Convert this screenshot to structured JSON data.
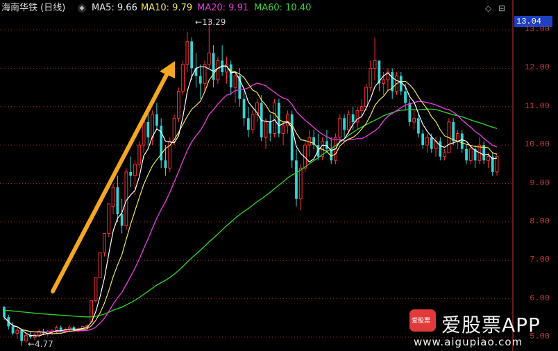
{
  "header": {
    "title": "海南华铁 (日线)",
    "ma5": "MA5: 9.66",
    "ma10": "MA10: 9.79",
    "ma20": "MA20: 9.91",
    "ma60": "MA60: 10.40"
  },
  "current_price": "13.04",
  "watermark": {
    "logo_text": "爱股票",
    "name": "爱股票APP",
    "url": "www.aigupiao.com"
  },
  "colors": {
    "up": "#ff3030",
    "down": "#35d4d4",
    "ma5": "#ffffff",
    "ma10": "#f2e65a",
    "ma20": "#e23ad8",
    "ma60": "#2ecc2e",
    "arrow": "#f5a623",
    "axis": "#c23a3a",
    "grid": "#a0282a"
  },
  "chart_data": {
    "type": "candlestick",
    "title": "海南华铁 (日线)",
    "y_ticks": [
      "13.00",
      "12.00",
      "11.00",
      "10.00",
      "9.00",
      "8.00",
      "7.00",
      "6.00",
      "5.00"
    ],
    "ylim": [
      4.6,
      13.3
    ],
    "annotations": {
      "high": "13.29",
      "low": "4.77"
    },
    "ohlc": [
      [
        5.78,
        5.82,
        5.45,
        5.52
      ],
      [
        5.52,
        5.58,
        5.2,
        5.28
      ],
      [
        5.28,
        5.4,
        5.05,
        5.1
      ],
      [
        5.1,
        5.25,
        4.95,
        5.18
      ],
      [
        5.18,
        5.22,
        4.77,
        4.9
      ],
      [
        4.9,
        5.1,
        4.85,
        5.05
      ],
      [
        5.05,
        5.15,
        4.95,
        5.0
      ],
      [
        5.0,
        5.1,
        4.92,
        5.06
      ],
      [
        5.06,
        5.2,
        5.0,
        5.15
      ],
      [
        5.15,
        5.22,
        5.05,
        5.1
      ],
      [
        5.1,
        5.18,
        5.02,
        5.14
      ],
      [
        5.14,
        5.2,
        5.06,
        5.18
      ],
      [
        5.18,
        5.3,
        5.1,
        5.25
      ],
      [
        5.25,
        5.3,
        5.12,
        5.16
      ],
      [
        5.16,
        5.25,
        5.1,
        5.2
      ],
      [
        5.2,
        5.3,
        5.15,
        5.26
      ],
      [
        5.26,
        5.3,
        5.15,
        5.18
      ],
      [
        5.18,
        5.25,
        5.12,
        5.22
      ],
      [
        5.22,
        5.3,
        5.15,
        5.28
      ],
      [
        5.28,
        5.35,
        5.2,
        5.3
      ],
      [
        5.4,
        5.95,
        5.4,
        5.95
      ],
      [
        5.95,
        6.55,
        5.9,
        6.55
      ],
      [
        6.55,
        7.2,
        6.55,
        7.2
      ],
      [
        7.2,
        7.7,
        7.1,
        7.7
      ],
      [
        7.7,
        8.47,
        7.6,
        8.47
      ],
      [
        8.4,
        9.0,
        8.2,
        8.9
      ],
      [
        8.9,
        9.2,
        8.0,
        8.2
      ],
      [
        8.2,
        8.6,
        7.7,
        7.9
      ],
      [
        7.9,
        9.4,
        7.8,
        9.3
      ],
      [
        9.3,
        9.7,
        8.9,
        9.2
      ],
      [
        9.2,
        9.6,
        8.7,
        9.5
      ],
      [
        9.5,
        10.1,
        9.4,
        10.0
      ],
      [
        10.0,
        10.7,
        9.8,
        10.6
      ],
      [
        10.6,
        10.9,
        10.0,
        10.2
      ],
      [
        10.2,
        10.9,
        10.0,
        10.8
      ],
      [
        10.8,
        11.1,
        10.4,
        10.5
      ],
      [
        10.5,
        10.7,
        9.4,
        9.6
      ],
      [
        9.6,
        10.0,
        9.2,
        9.4
      ],
      [
        9.4,
        10.2,
        9.3,
        10.1
      ],
      [
        10.1,
        10.8,
        10.0,
        10.7
      ],
      [
        10.7,
        11.5,
        10.6,
        11.4
      ],
      [
        11.4,
        12.2,
        11.3,
        12.1
      ],
      [
        12.1,
        12.95,
        11.9,
        12.7
      ],
      [
        12.7,
        12.8,
        11.7,
        12.0
      ],
      [
        12.0,
        12.4,
        11.5,
        11.8
      ],
      [
        11.8,
        12.1,
        11.2,
        11.6
      ],
      [
        11.6,
        12.2,
        11.4,
        12.1
      ],
      [
        12.1,
        13.29,
        12.0,
        12.4
      ],
      [
        12.4,
        12.6,
        11.5,
        11.7
      ],
      [
        11.7,
        12.3,
        11.6,
        12.2
      ],
      [
        12.2,
        12.6,
        11.8,
        11.9
      ],
      [
        11.9,
        12.3,
        11.6,
        12.1
      ],
      [
        12.1,
        12.2,
        11.3,
        11.5
      ],
      [
        11.5,
        11.9,
        11.1,
        11.8
      ],
      [
        11.8,
        12.0,
        11.0,
        11.2
      ],
      [
        11.2,
        11.4,
        10.5,
        10.7
      ],
      [
        10.7,
        11.0,
        10.2,
        10.4
      ],
      [
        10.4,
        10.9,
        10.3,
        10.8
      ],
      [
        10.8,
        11.2,
        10.6,
        11.1
      ],
      [
        11.1,
        11.3,
        10.1,
        10.2
      ],
      [
        10.2,
        10.7,
        9.9,
        10.6
      ],
      [
        10.6,
        10.8,
        10.1,
        10.3
      ],
      [
        10.3,
        11.2,
        10.2,
        11.1
      ],
      [
        11.1,
        11.2,
        10.2,
        10.3
      ],
      [
        10.3,
        10.6,
        10.0,
        10.5
      ],
      [
        10.5,
        10.9,
        10.3,
        10.8
      ],
      [
        10.8,
        10.9,
        9.4,
        9.6
      ],
      [
        9.6,
        9.9,
        8.4,
        8.6
      ],
      [
        8.6,
        9.5,
        8.3,
        9.4
      ],
      [
        9.4,
        10.1,
        9.3,
        10.0
      ],
      [
        10.0,
        10.4,
        9.7,
        10.2
      ],
      [
        10.2,
        10.4,
        9.9,
        10.0
      ],
      [
        10.0,
        10.3,
        9.6,
        9.7
      ],
      [
        9.7,
        10.2,
        9.6,
        10.1
      ],
      [
        10.1,
        10.4,
        9.8,
        9.9
      ],
      [
        9.9,
        10.2,
        9.5,
        9.6
      ],
      [
        9.6,
        10.3,
        9.5,
        10.2
      ],
      [
        10.2,
        10.8,
        10.1,
        10.7
      ],
      [
        10.7,
        10.8,
        10.2,
        10.4
      ],
      [
        10.4,
        10.9,
        10.3,
        10.8
      ],
      [
        10.8,
        11.0,
        10.4,
        10.6
      ],
      [
        10.6,
        11.0,
        10.4,
        10.9
      ],
      [
        10.9,
        11.2,
        10.7,
        11.0
      ],
      [
        11.0,
        11.6,
        10.9,
        11.5
      ],
      [
        11.5,
        12.2,
        11.4,
        12.0
      ],
      [
        12.0,
        12.8,
        11.7,
        12.2
      ],
      [
        12.2,
        12.2,
        11.4,
        11.6
      ],
      [
        11.6,
        11.9,
        11.3,
        11.7
      ],
      [
        11.7,
        12.0,
        11.4,
        11.9
      ],
      [
        11.9,
        12.0,
        11.2,
        11.4
      ],
      [
        11.4,
        11.9,
        11.3,
        11.8
      ],
      [
        11.8,
        11.9,
        11.3,
        11.4
      ],
      [
        11.4,
        11.6,
        10.9,
        11.1
      ],
      [
        11.1,
        11.2,
        10.5,
        10.6
      ],
      [
        10.6,
        10.9,
        10.4,
        10.7
      ],
      [
        10.7,
        10.8,
        10.2,
        10.3
      ],
      [
        10.3,
        10.4,
        9.9,
        10.0
      ],
      [
        10.0,
        10.3,
        9.8,
        10.2
      ],
      [
        10.2,
        10.3,
        9.8,
        9.9
      ],
      [
        9.9,
        10.2,
        9.7,
        10.1
      ],
      [
        10.1,
        10.2,
        9.6,
        9.7
      ],
      [
        9.7,
        9.9,
        9.6,
        9.8
      ],
      [
        9.8,
        10.7,
        9.8,
        10.6
      ],
      [
        10.6,
        10.7,
        10.0,
        10.1
      ],
      [
        10.1,
        10.4,
        9.9,
        10.3
      ],
      [
        10.3,
        10.4,
        9.8,
        9.9
      ],
      [
        9.9,
        10.0,
        9.5,
        9.6
      ],
      [
        9.6,
        10.0,
        9.5,
        9.9
      ],
      [
        9.9,
        10.0,
        9.4,
        9.6
      ],
      [
        9.6,
        10.2,
        9.5,
        10.0
      ],
      [
        10.0,
        10.1,
        9.5,
        9.6
      ],
      [
        9.6,
        9.8,
        9.4,
        9.7
      ],
      [
        9.7,
        9.8,
        9.2,
        9.3
      ],
      [
        9.3,
        9.8,
        9.2,
        9.7
      ]
    ],
    "ma60_start": 5.7
  }
}
